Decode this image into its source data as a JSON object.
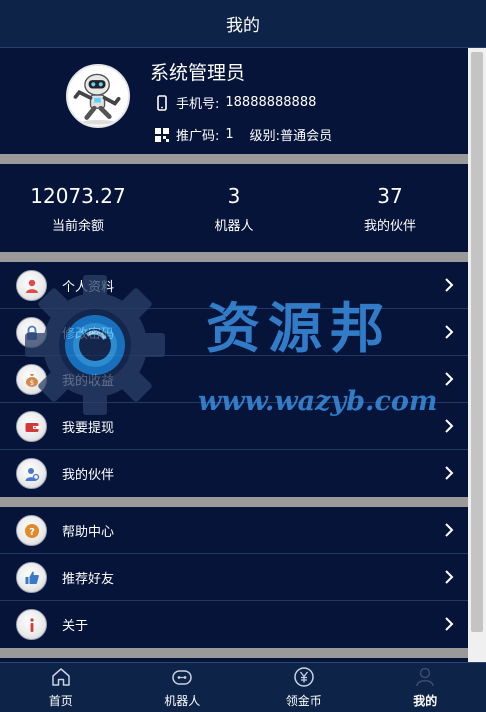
{
  "header": {
    "title": "我的"
  },
  "profile": {
    "name": "系统管理员",
    "phone_label": "手机号:",
    "phone_value": "18888888888",
    "promo_label": "推广码:",
    "promo_value": "1",
    "level_label": "级别:",
    "level_value": "普通会员",
    "avatar_icon": "robot-avatar"
  },
  "stats": [
    {
      "value": "12073.27",
      "label": "当前余额"
    },
    {
      "value": "3",
      "label": "机器人"
    },
    {
      "value": "37",
      "label": "我的伙伴"
    }
  ],
  "menu_group_1": [
    {
      "label": "个人资料",
      "icon": "user-icon",
      "icon_color": "#e04a4a"
    },
    {
      "label": "修改密码",
      "icon": "lock-icon",
      "icon_color": "#4a78c8"
    },
    {
      "label": "我的收益",
      "icon": "money-bag-icon",
      "icon_color": "#d4884a"
    },
    {
      "label": "我要提现",
      "icon": "wallet-icon",
      "icon_color": "#d23a3a"
    },
    {
      "label": "我的伙伴",
      "icon": "partner-icon",
      "icon_color": "#4a78c8"
    }
  ],
  "menu_group_2": [
    {
      "label": "帮助中心",
      "icon": "help-icon",
      "icon_color": "#e08a2a"
    },
    {
      "label": "推荐好友",
      "icon": "thumbs-up-icon",
      "icon_color": "#3a78c8"
    },
    {
      "label": "关于",
      "icon": "info-icon",
      "icon_color": "#d23a3a"
    }
  ],
  "watermark": {
    "title": "资源邦",
    "url": "www.wazyb.com"
  },
  "bottom_nav": [
    {
      "label": "首页",
      "icon": "home-icon",
      "active": false
    },
    {
      "label": "机器人",
      "icon": "robot-icon",
      "active": false
    },
    {
      "label": "领金币",
      "icon": "yen-coin-icon",
      "active": false
    },
    {
      "label": "我的",
      "icon": "profile-icon",
      "active": true
    }
  ],
  "colors": {
    "background": "#06143a",
    "header": "#0d2347",
    "divider": "#9a9a9a",
    "watermark": "#3a8fe0"
  }
}
